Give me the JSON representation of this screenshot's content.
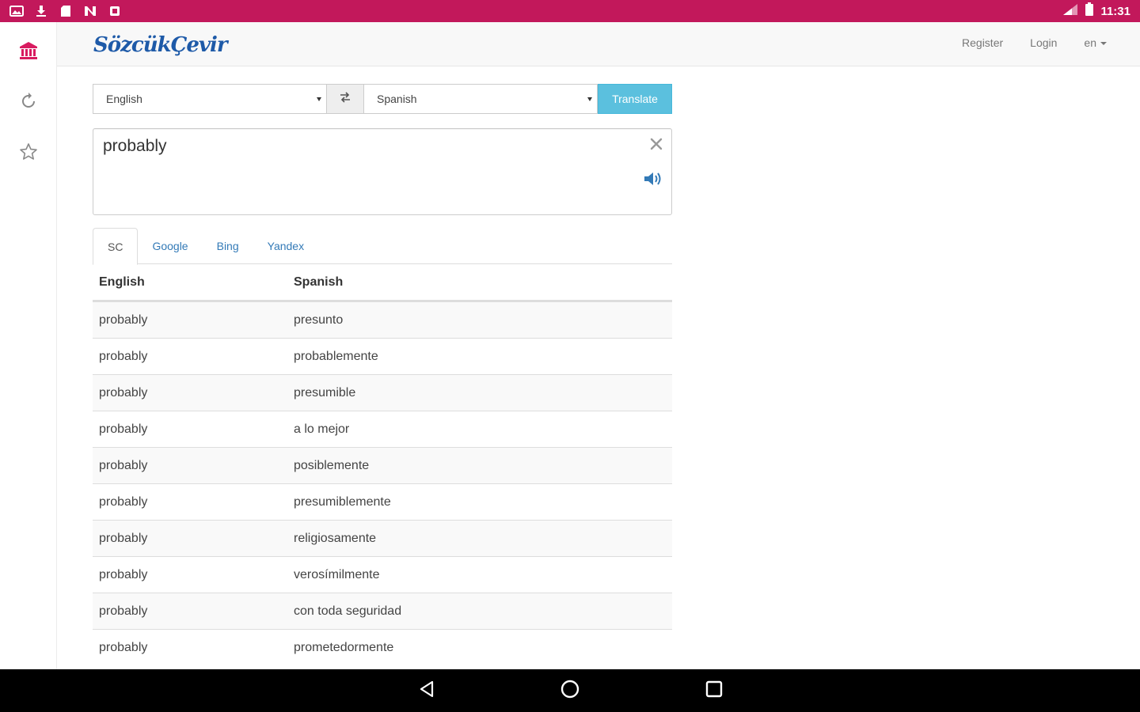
{
  "status_bar": {
    "left_icons": [
      "gallery-icon",
      "download-icon",
      "sd-card-icon",
      "n-icon",
      "square-app-icon"
    ],
    "time": "11:31"
  },
  "rail": {
    "items": [
      {
        "icon": "bank-icon",
        "active": true
      },
      {
        "icon": "history-icon",
        "active": false
      },
      {
        "icon": "star-icon",
        "active": false
      }
    ]
  },
  "navbar": {
    "logo": "SözcükÇevir",
    "register": "Register",
    "login": "Login",
    "lang": "en"
  },
  "translator": {
    "source_lang": "English",
    "target_lang": "Spanish",
    "translate_label": "Translate",
    "input_text": "probably"
  },
  "tabs": [
    "SC",
    "Google",
    "Bing",
    "Yandex"
  ],
  "table": {
    "headers": [
      "English",
      "Spanish"
    ],
    "rows": [
      [
        "probably",
        "presunto"
      ],
      [
        "probably",
        "probablemente"
      ],
      [
        "probably",
        "presumible"
      ],
      [
        "probably",
        "a lo mejor"
      ],
      [
        "probably",
        "posiblemente"
      ],
      [
        "probably",
        "presumiblemente"
      ],
      [
        "probably",
        "religiosamente"
      ],
      [
        "probably",
        "verosímilmente"
      ],
      [
        "probably",
        "con toda seguridad"
      ],
      [
        "probably",
        "prometedormente"
      ]
    ]
  },
  "colors": {
    "status_bar": "#c2185b",
    "accent_active": "#d81b60",
    "translate_button": "#5bc0de",
    "link": "#337ab7"
  }
}
